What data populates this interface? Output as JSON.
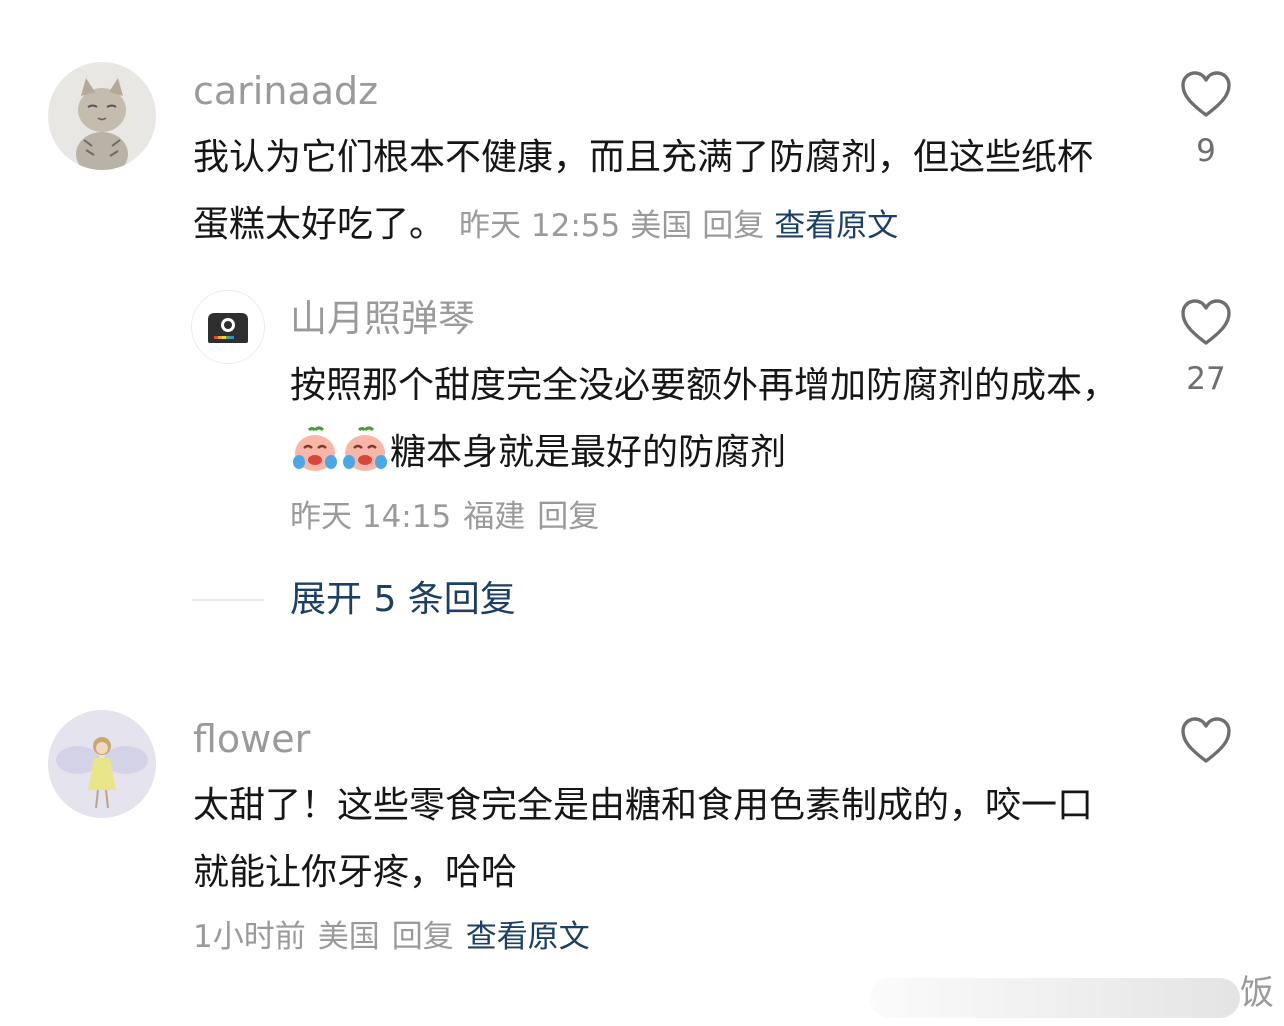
{
  "comments": [
    {
      "username": "carinaadz",
      "text": "我认为它们根本不健康，而且充满了防腐剂，但这些纸杯蛋糕太好吃了。",
      "time": "昨天 12:55",
      "location": "美国",
      "reply_label": "回复",
      "translate_label": "查看原文",
      "like_count": "9",
      "avatar_icon": "cat-avatar-icon"
    },
    {
      "username": "flower",
      "text": "太甜了！这些零食完全是由糖和食用色素制成的，咬一口就能让你牙疼，哈哈",
      "time": "1小时前",
      "location": "美国",
      "reply_label": "回复",
      "translate_label": "查看原文",
      "like_count": "",
      "avatar_icon": "fairy-avatar-icon"
    }
  ],
  "reply": {
    "username": "山月照弹琴",
    "text_before": "按照那个甜度完全没必要额外再增加防腐剂的成本，",
    "text_after": "糖本身就是最好的防腐剂",
    "emoji": [
      "crying-laughing-emoji",
      "crying-laughing-emoji"
    ],
    "time": "昨天 14:15",
    "location": "福建",
    "reply_label": "回复",
    "like_count": "27",
    "avatar_icon": "camera-avatar-icon"
  },
  "expand_replies_label": "展开 5 条回复",
  "watermark_char": "饭",
  "colors": {
    "link": "#1b3f66",
    "meta": "#9a9a9a",
    "text": "#161616"
  }
}
